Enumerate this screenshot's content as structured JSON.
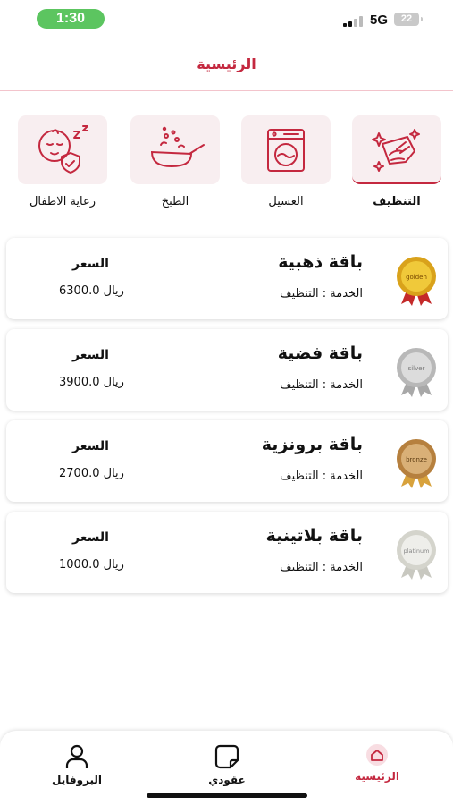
{
  "status_bar": {
    "time": "1:30",
    "network": "5G",
    "battery": "22"
  },
  "header": {
    "title": "الرئيسية"
  },
  "categories": [
    {
      "label": "التنظيف",
      "icon": "cleaning-icon",
      "selected": true
    },
    {
      "label": "الغسيل",
      "icon": "washing-machine-icon",
      "selected": false
    },
    {
      "label": "الطبخ",
      "icon": "cooking-pan-icon",
      "selected": false
    },
    {
      "label": "رعاية الاطفال",
      "icon": "baby-care-icon",
      "selected": false
    }
  ],
  "packages": [
    {
      "name": "باقة ذهبية",
      "service": "الخدمة : التنظيف",
      "price_label": "السعر",
      "price": "6300.0 ريال",
      "medal_text": "golden",
      "medal_color": "#d9a21b"
    },
    {
      "name": "باقة فضية",
      "service": "الخدمة : التنظيف",
      "price_label": "السعر",
      "price": "3900.0 ريال",
      "medal_text": "silver",
      "medal_color": "#b8b8b8"
    },
    {
      "name": "باقة برونزية",
      "service": "الخدمة : التنظيف",
      "price_label": "السعر",
      "price": "2700.0 ريال",
      "medal_text": "bronze",
      "medal_color": "#c89a55"
    },
    {
      "name": "باقة بلاتينية",
      "service": "الخدمة : التنظيف",
      "price_label": "السعر",
      "price": "1000.0 ريال",
      "medal_text": "platinum",
      "medal_color": "#dcdcd6"
    }
  ],
  "bottom_nav": [
    {
      "label": "الرئيسية",
      "icon": "home-icon",
      "active": true
    },
    {
      "label": "عقودي",
      "icon": "contracts-icon",
      "active": false
    },
    {
      "label": "البروفايل",
      "icon": "profile-icon",
      "active": false
    }
  ],
  "colors": {
    "accent": "#c4283f",
    "category_bg": "#f8eef0",
    "status_green": "#5cc560"
  }
}
